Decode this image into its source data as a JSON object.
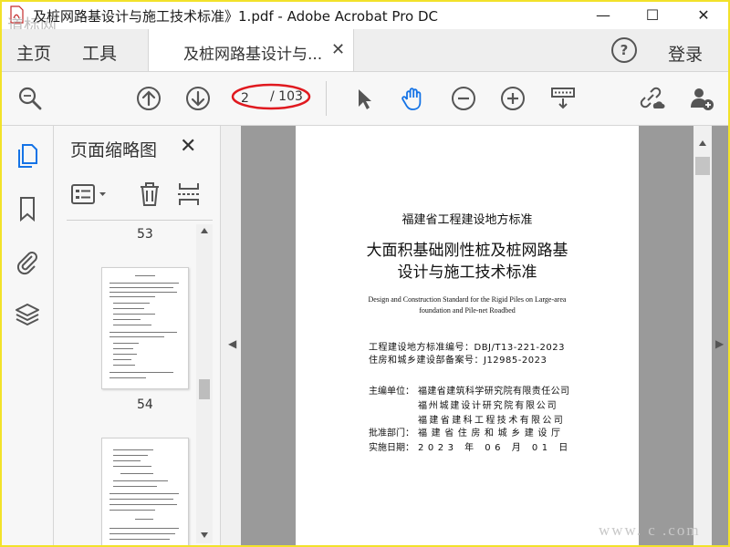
{
  "window": {
    "title": "及桩网路基设计与施工技术标准》1.pdf - Adobe Acrobat Pro DC",
    "minimize": "—",
    "maximize": "☐",
    "close": "✕"
  },
  "tabs": {
    "home": "主页",
    "tools": "工具",
    "document": "及桩网路基设计与...",
    "document_close": "✕",
    "help": "?",
    "login": "登录"
  },
  "toolbar": {
    "current_page": "2",
    "total_pages": "/ 103",
    "icons": [
      "search-icon",
      "page-up-icon",
      "page-down-icon",
      "select-cursor-icon",
      "hand-tool-icon",
      "zoom-out-icon",
      "zoom-in-icon",
      "scroll-mode-icon",
      "share-link-icon",
      "add-user-icon"
    ],
    "accent_color": "#1473e6",
    "highlight_color": "#e0191f"
  },
  "rail": {
    "icons": [
      "page-thumbnails-icon",
      "bookmarks-icon",
      "attachments-icon",
      "layers-icon"
    ]
  },
  "thumbnails": {
    "title": "页面缩略图",
    "close": "✕",
    "page_labels": [
      "53",
      "54"
    ]
  },
  "document": {
    "org": "福建省工程建设地方标准",
    "title_line1": "大面积基础刚性桩及桩网路基",
    "title_line2": "设计与施工技术标准",
    "english_line1": "Design and Construction Standard for the Rigid Piles on Large-area",
    "english_line2": "foundation and Pile-net Roadbed",
    "standard_no": "工程建设地方标准编号：DBJ/T13-221-2023",
    "record_no": "住房和城乡建设部备案号：J12985-2023",
    "chief_label": "主编单位：",
    "chief_units": [
      "福建省建筑科学研究院有限责任公司",
      "福州城建设计研究院有限公司",
      "福建省建科工程技术有限公司"
    ],
    "approval_label": "批准部门：",
    "approval": "福建省住房和城乡建设厅",
    "date_label": "实施日期：",
    "date": "2023 年 06 月 01 日"
  },
  "watermark": {
    "top_left": "道标网",
    "bottom_right": "www. c   .com"
  }
}
